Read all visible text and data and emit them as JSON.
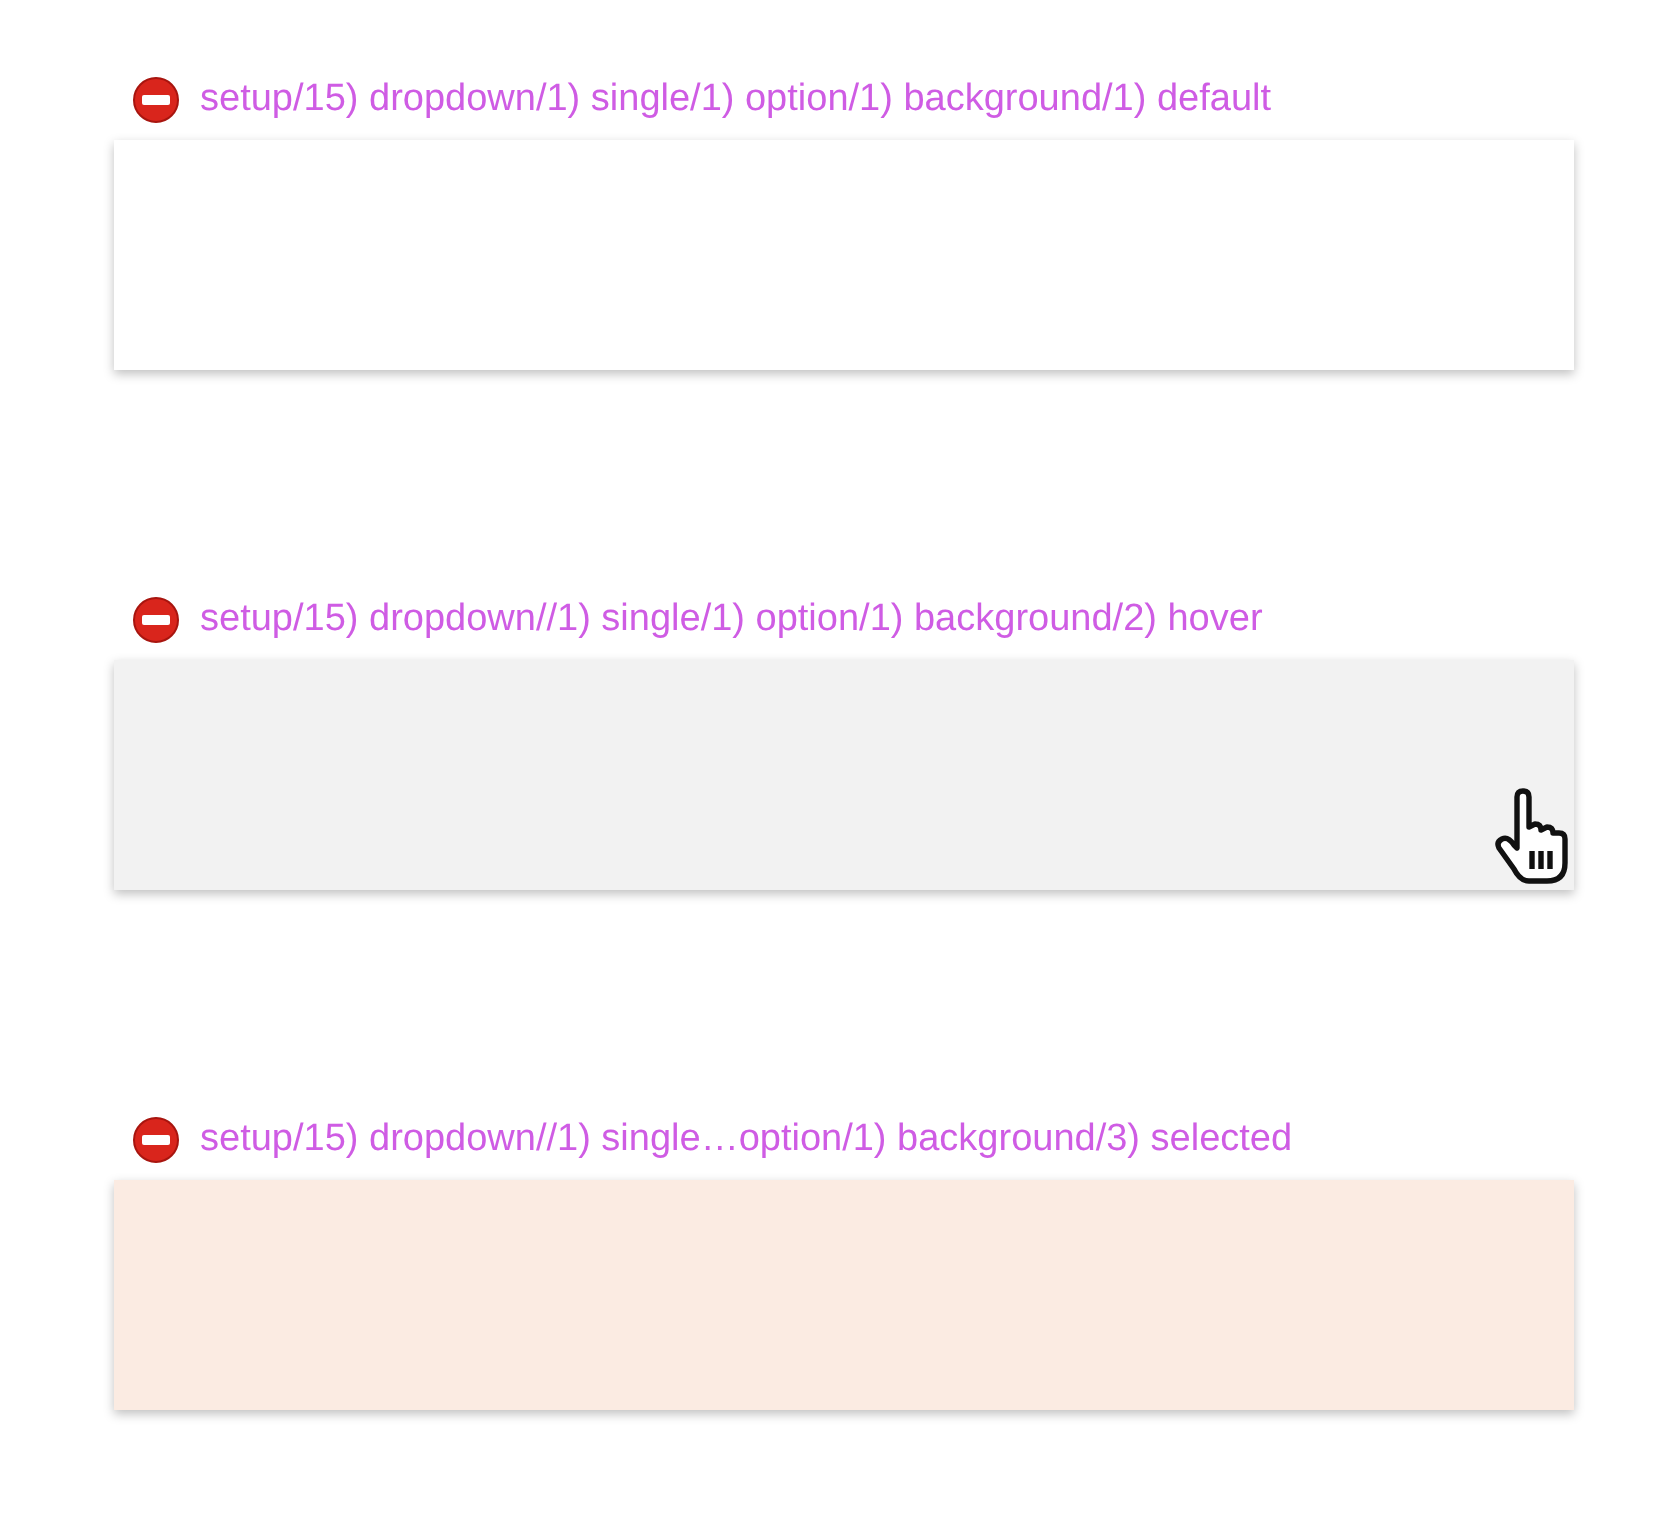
{
  "sections": [
    {
      "title": "setup/15) dropdown/1) single/1) option/1) background/1) default",
      "hovered": false,
      "selected": false
    },
    {
      "title": "setup/15) dropdown//1) single/1) option/1) background/2) hover",
      "hovered": true,
      "selected": false
    },
    {
      "title": "setup/15) dropdown//1) single…option/1) background/3) selected",
      "hovered": false,
      "selected": true
    }
  ]
}
